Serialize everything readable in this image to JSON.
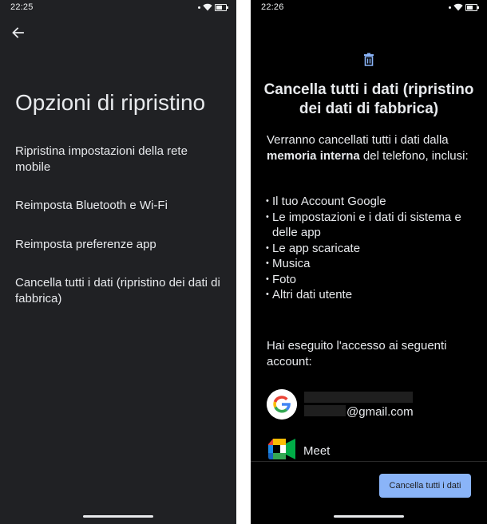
{
  "left": {
    "status_time": "22:25",
    "title": "Opzioni di ripristino",
    "options": [
      "Ripristina impostazioni della rete mobile",
      "Reimposta Bluetooth e Wi-Fi",
      "Reimposta preferenze app",
      "Cancella tutti i dati (ripristino dei dati di fabbrica)"
    ]
  },
  "right": {
    "status_time": "22:26",
    "title": "Cancella tutti i dati (ripristino dei dati di fabbrica)",
    "intro_before": "Verranno cancellati tutti i dati dalla ",
    "intro_bold": "memoria interna",
    "intro_after": " del telefono, inclusi:",
    "items": [
      "Il tuo Account Google",
      "Le impostazioni e i dati di sistema e delle app",
      "Le app scaricate",
      "Musica",
      "Foto",
      "Altri dati utente"
    ],
    "accounts_heading": "Hai eseguito l'accesso ai seguenti account:",
    "account_email": "@gmail.com",
    "meet_label": "Meet",
    "erase_button": "Cancella tutti i dati"
  },
  "colors": {
    "left_bg": "#202124",
    "right_bg": "#000000",
    "accent": "#8ab4f8",
    "text": "#e8eaed"
  },
  "icons": [
    "back-arrow-icon",
    "wifi-icon",
    "battery-icon",
    "trash-icon",
    "google-logo-icon",
    "meet-logo-icon"
  ]
}
